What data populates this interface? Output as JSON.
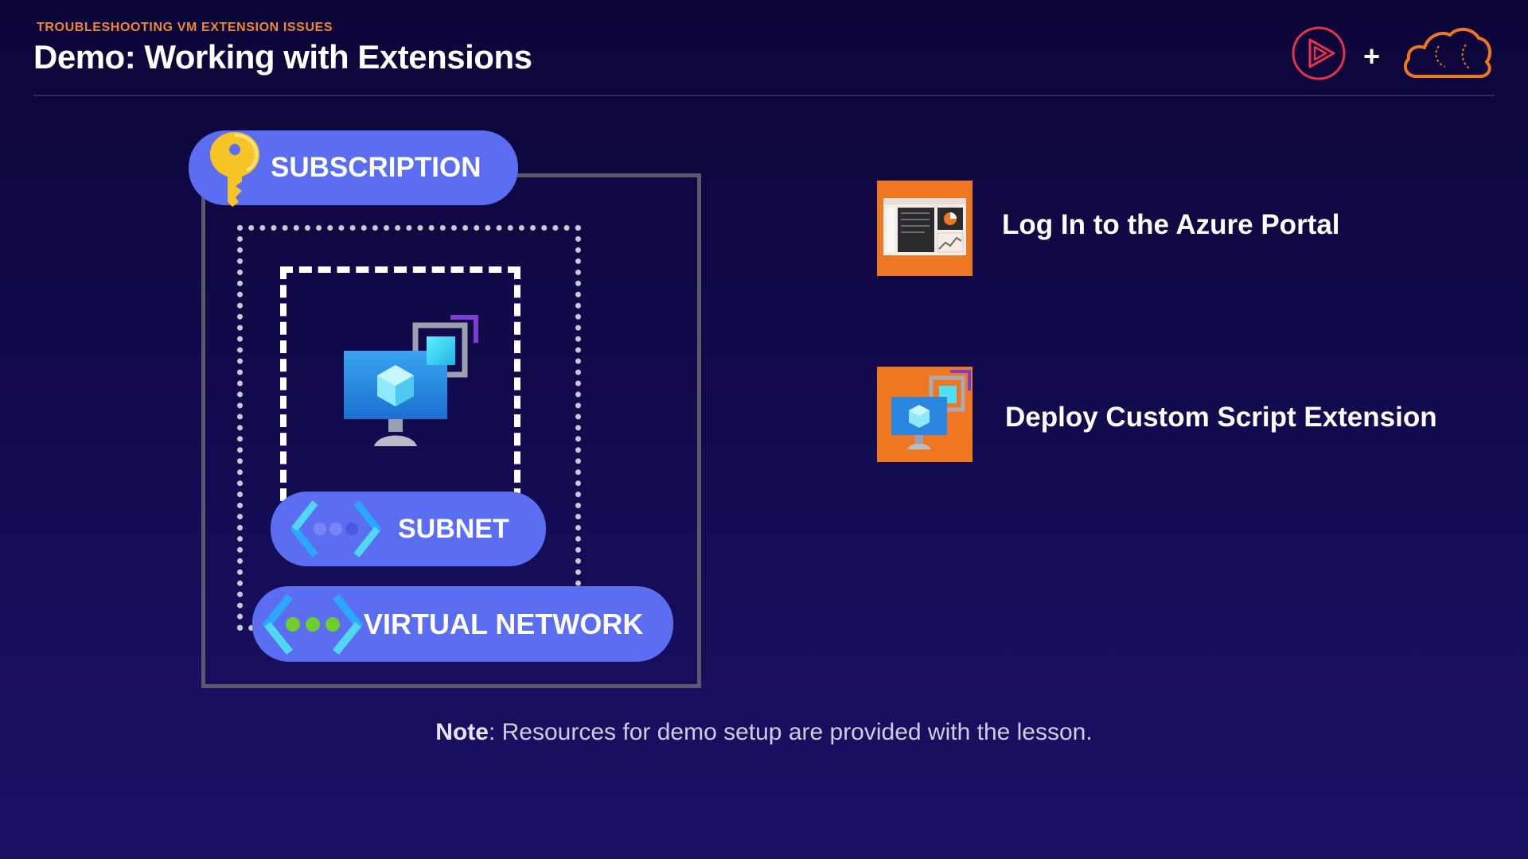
{
  "header": {
    "eyebrow": "TROUBLESHOOTING VM EXTENSION ISSUES",
    "title": "Demo: Working with Extensions",
    "plus": "+"
  },
  "diagram": {
    "subscription_label": "SUBSCRIPTION",
    "subnet_label": "SUBNET",
    "vnet_label": "VIRTUAL NETWORK"
  },
  "steps": [
    {
      "label": "Log In to the Azure Portal",
      "icon": "portal-screenshot-icon"
    },
    {
      "label": "Deploy Custom Script Extension",
      "icon": "vm-extension-icon"
    }
  ],
  "note": {
    "prefix": "Note",
    "text": ": Resources for demo setup are provided with the lesson."
  },
  "colors": {
    "accent_orange": "#f07722",
    "pill_blue": "#5b6ef2",
    "background": "#110a4a"
  }
}
